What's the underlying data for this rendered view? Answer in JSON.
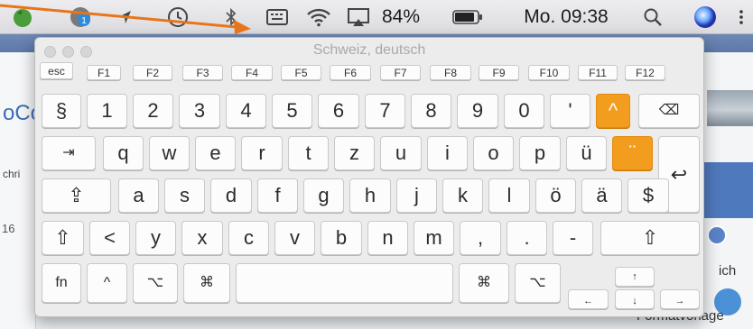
{
  "menubar": {
    "battery_percent": "84%",
    "clock": "Mo. 09:38",
    "status_icons": [
      "evernote-icon",
      "updates-icon",
      "location-icon",
      "time-machine-icon",
      "bluetooth-icon",
      "input-menu-icon",
      "wifi-icon",
      "airplay-icon",
      "battery-icon",
      "spotlight-icon",
      "siri-icon"
    ]
  },
  "background_app": {
    "frag_1": "oCo",
    "frag_2": "chri",
    "frag_3": "16",
    "frag_4": "ich",
    "frag_5": "Formatvorlage"
  },
  "keyboard_viewer": {
    "title": "Schweiz, deutsch",
    "function_row": [
      "esc",
      "F1",
      "F2",
      "F3",
      "F4",
      "F5",
      "F6",
      "F7",
      "F8",
      "F9",
      "F10",
      "F11",
      "F12"
    ],
    "number_row": [
      "§",
      "1",
      "2",
      "3",
      "4",
      "5",
      "6",
      "7",
      "8",
      "9",
      "0",
      "'",
      "^",
      "⌫"
    ],
    "qwertz_row": [
      "⇥",
      "q",
      "w",
      "e",
      "r",
      "t",
      "z",
      "u",
      "i",
      "o",
      "p",
      "ü",
      "¨",
      "↩"
    ],
    "home_row": [
      "⇪",
      "a",
      "s",
      "d",
      "f",
      "g",
      "h",
      "j",
      "k",
      "l",
      "ö",
      "ä",
      "$"
    ],
    "shift_row": [
      "⇧",
      "<",
      "y",
      "x",
      "c",
      "v",
      "b",
      "n",
      "m",
      ",",
      ".",
      "-",
      "⇧"
    ],
    "bottom_row": [
      "fn",
      "^",
      "⌥",
      "⌘",
      "",
      "⌘",
      "⌥"
    ],
    "arrows": {
      "up": "↑",
      "left": "←",
      "down": "↓",
      "right": "→"
    },
    "accent_color": "#f29d1e"
  }
}
